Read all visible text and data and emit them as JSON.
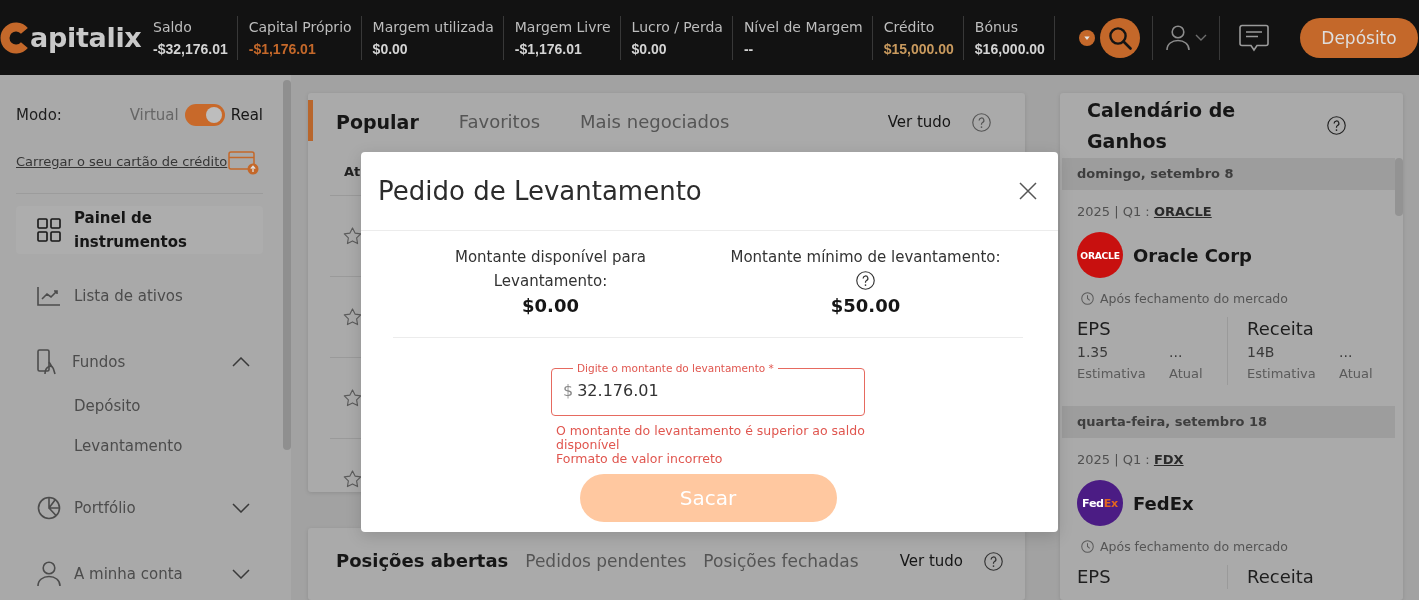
{
  "top_bar": {
    "logo_text": "apitalix",
    "stats": [
      {
        "label": "Saldo",
        "value": "-$32,176.01",
        "color": "#d4d4d4"
      },
      {
        "label": "Capital Próprio",
        "value": "-$1,176.01",
        "color": "#c4682a"
      },
      {
        "label": "Margem utilizada",
        "value": "$0.00",
        "color": "#d4d4d4"
      },
      {
        "label": "Margem Livre",
        "value": "-$1,176.01",
        "color": "#d4d4d4"
      },
      {
        "label": "Lucro / Perda",
        "value": "$0.00",
        "color": "#d4d4d4"
      },
      {
        "label": "Nível de Margem",
        "value": "--",
        "color": "#d4d4d4"
      },
      {
        "label": "Crédito",
        "value": "$15,000.00",
        "color": "#c99a5e"
      },
      {
        "label": "Bónus",
        "value": "$16,000.00",
        "color": "#d4d4d4"
      }
    ],
    "deposit_button": "Depósito"
  },
  "sidebar": {
    "mode": {
      "label": "Modo:",
      "off_label": "Virtual",
      "on_label": "Real",
      "on": true
    },
    "card_link": "Carregar o seu cartão de crédito",
    "items": [
      {
        "kind": "link",
        "label": "Painel de instrumentos",
        "selected": true
      },
      {
        "kind": "link",
        "label": "Lista de ativos",
        "selected": false
      },
      {
        "kind": "group",
        "label": "Fundos",
        "selected": false,
        "expanded": true,
        "children": [
          {
            "label": "Depósito",
            "selected": false
          },
          {
            "label": "Levantamento",
            "selected": false
          }
        ]
      },
      {
        "kind": "group",
        "label": "Portfólio",
        "selected": false,
        "expanded": false
      },
      {
        "kind": "group",
        "label": "A minha conta",
        "selected": false,
        "expanded": false
      }
    ]
  },
  "popular_panel": {
    "tabs": [
      {
        "label": "Popular",
        "selected": true
      },
      {
        "label": "Favoritos",
        "selected": false
      },
      {
        "label": "Mais negociados",
        "selected": false
      }
    ],
    "see_all": "Ver tudo",
    "table": {
      "columns": [
        "At"
      ],
      "rows": [
        {
          "favorite": false
        },
        {
          "favorite": false
        },
        {
          "favorite": false
        },
        {
          "favorite": false
        }
      ]
    }
  },
  "positions_panel": {
    "tabs": [
      {
        "label": "Posições abertas",
        "selected": true
      },
      {
        "label": "Pedidos pendentes",
        "selected": false
      },
      {
        "label": "Posições fechadas",
        "selected": false
      }
    ],
    "see_all": "Ver tudo"
  },
  "earnings_calendar": {
    "title": "Calendário de Ganhos",
    "days": [
      {
        "date": "domingo, setembro 8",
        "events": [
          {
            "period": "2025 | Q1 :",
            "ticker": "ORACLE",
            "logo": {
              "color": "#c8100f",
              "text": [
                {
                  "text": "ORACLE",
                  "color": "#ffffff"
                }
              ]
            },
            "company": "Oracle Corp",
            "timing": "Após fechamento do mercado",
            "metrics": [
              {
                "title": "EPS",
                "estimate": "1.35",
                "actual": "...",
                "estimate_label": "Estimativa",
                "actual_label": "Atual"
              },
              {
                "title": "Receita",
                "estimate": "14B",
                "actual": "...",
                "estimate_label": "Estimativa",
                "actual_label": "Atual"
              }
            ]
          }
        ]
      },
      {
        "date": "quarta-feira, setembro 18",
        "events": [
          {
            "period": "2025 | Q1 :",
            "ticker": "FDX",
            "logo": {
              "color": "#4b1c84",
              "text": [
                {
                  "text": "Fed",
                  "color": "#ffffff"
                },
                {
                  "text": "Ex",
                  "color": "#e2661f"
                }
              ]
            },
            "company": "FedEx",
            "timing": "Após fechamento do mercado",
            "metrics": [
              {
                "title": "EPS"
              },
              {
                "title": "Receita"
              }
            ]
          }
        ]
      }
    ]
  },
  "withdraw_dialog": {
    "title": "Pedido de Levantamento",
    "available": {
      "label": "Montante disponível para Levantamento:",
      "value": "$0.00"
    },
    "minimum": {
      "label": "Montante mínimo de levantamento:",
      "value": "$50.00"
    },
    "amount_field": {
      "label": "Digite o montante do levantamento *",
      "currency": "$",
      "value": "32.176.01",
      "error": true
    },
    "errors": [
      "O montante do levantamento é superior ao saldo disponível",
      "Formato de valor incorreto"
    ],
    "submit": {
      "label": "Sacar",
      "disabled": true
    }
  }
}
